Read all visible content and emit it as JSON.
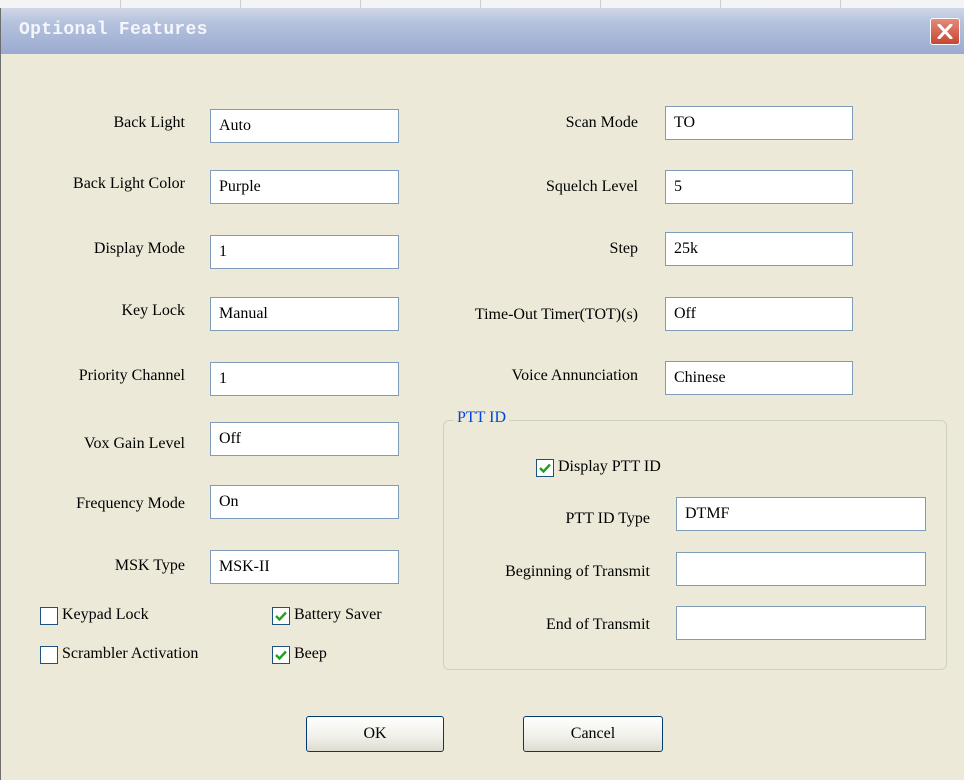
{
  "window": {
    "title": "Optional Features"
  },
  "left_fields": [
    {
      "label": "Back Light",
      "value": "Auto"
    },
    {
      "label": "Back Light Color",
      "value": "Purple"
    },
    {
      "label": "Display Mode",
      "value": "1"
    },
    {
      "label": "Key Lock",
      "value": "Manual"
    },
    {
      "label": "Priority Channel",
      "value": "1"
    },
    {
      "label": "Vox Gain Level",
      "value": "Off"
    },
    {
      "label": "Frequency Mode",
      "value": "On"
    },
    {
      "label": "MSK Type",
      "value": "MSK-II"
    }
  ],
  "right_fields": [
    {
      "label": "Scan Mode",
      "value": "TO"
    },
    {
      "label": "Squelch Level",
      "value": "5"
    },
    {
      "label": "Step",
      "value": "25k"
    },
    {
      "label": "Time-Out Timer(TOT)(s)",
      "value": "Off"
    },
    {
      "label": "Voice Annunciation",
      "value": "Chinese"
    }
  ],
  "checkboxes": {
    "keypad_lock": {
      "label": "Keypad Lock",
      "checked": false
    },
    "battery_saver": {
      "label": "Battery Saver",
      "checked": true
    },
    "scrambler_activation": {
      "label": "Scrambler Activation",
      "checked": false
    },
    "beep": {
      "label": "Beep",
      "checked": true
    }
  },
  "ptt_id": {
    "group_label": "PTT ID",
    "display_ptt_id": {
      "label": "Display PTT ID",
      "checked": true
    },
    "type": {
      "label": "PTT ID Type",
      "value": "DTMF"
    },
    "begin": {
      "label": "Beginning of Transmit",
      "value": ""
    },
    "end": {
      "label": "End of Transmit",
      "value": ""
    }
  },
  "buttons": {
    "ok": "OK",
    "cancel": "Cancel"
  },
  "colors": {
    "title_bar": "#a6b5d6",
    "dialog_bg": "#ece9d8",
    "check_mark": "#21a121",
    "group_label": "#0046d5",
    "close_button": "#c7452f"
  },
  "icons": {
    "close": "close-icon",
    "check": "checkmark-icon"
  }
}
